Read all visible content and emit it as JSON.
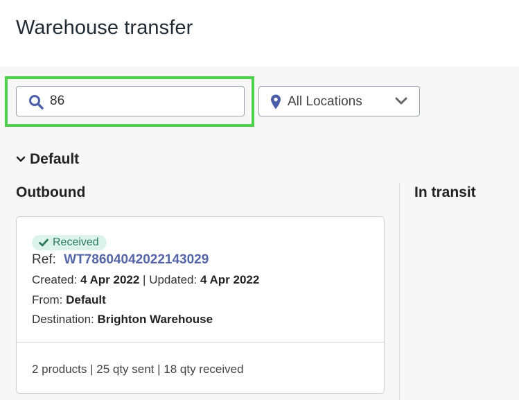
{
  "header": {
    "title": "Warehouse transfer"
  },
  "filters": {
    "search_value": "86",
    "location_label": "All Locations"
  },
  "group": {
    "label": "Default"
  },
  "columns": {
    "outbound": "Outbound",
    "in_transit": "In transit"
  },
  "colors": {
    "highlight": "#4ed14a",
    "accent": "#5365a6",
    "badge_bg": "#dbf3ea",
    "badge_text": "#2c7a5b"
  },
  "card": {
    "status": "Received",
    "ref_label": "Ref:",
    "ref": "WT78604042022143029",
    "created_label": "Created:",
    "created": "4 Apr 2022",
    "sep": "|",
    "updated_label": "Updated:",
    "updated": "4 Apr 2022",
    "from_label": "From:",
    "from": "Default",
    "destination_label": "Destination:",
    "destination": "Brighton Warehouse",
    "summary": "2 products | 25 qty sent | 18 qty received"
  },
  "icons": {
    "search": "search-icon",
    "location": "map-pin-icon",
    "dropdown": "chevron-down-icon",
    "status": "check-icon"
  }
}
